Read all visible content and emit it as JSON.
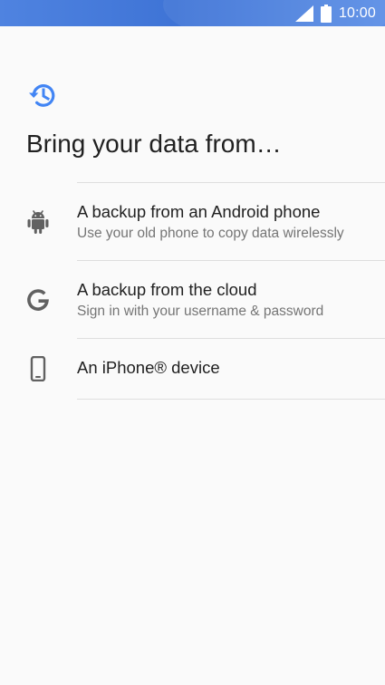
{
  "status_bar": {
    "time": "10:00",
    "signal_icon": "signal-icon",
    "battery_icon": "battery-icon"
  },
  "header": {
    "icon": "history-icon",
    "title": "Bring your data from…"
  },
  "options": [
    {
      "icon": "android-icon",
      "title": "A backup from an Android phone",
      "subtitle": "Use your old phone to copy data wirelessly"
    },
    {
      "icon": "google-icon",
      "title": "A backup from the cloud",
      "subtitle": "Sign in with your username & password"
    },
    {
      "icon": "phone-icon",
      "title": "An iPhone® device"
    }
  ],
  "colors": {
    "status_bar": "#4a7fdd",
    "accent": "#4285f4",
    "icon": "#616161",
    "title": "#212121",
    "subtitle": "#757575",
    "divider": "#dedede",
    "background": "#fafafa"
  }
}
